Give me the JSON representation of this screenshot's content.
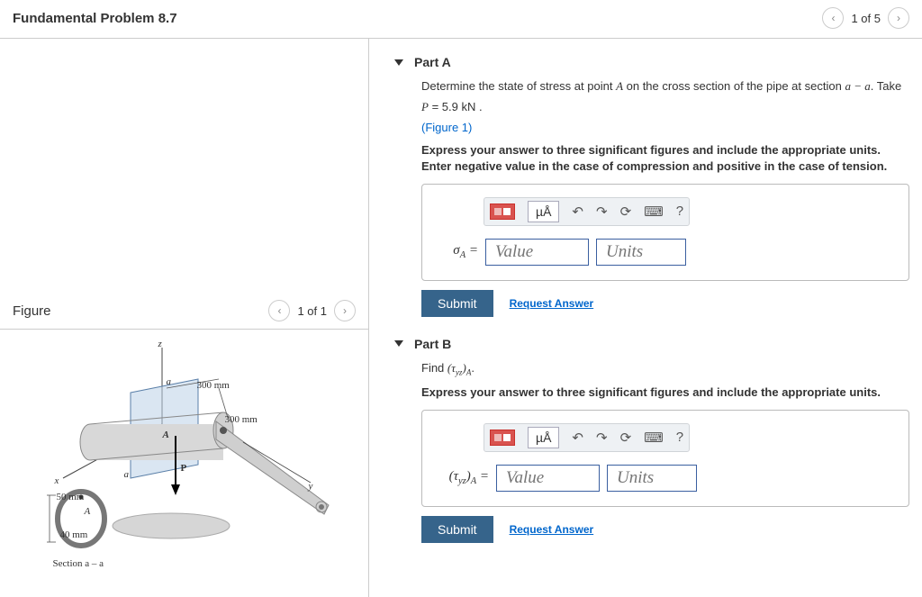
{
  "header": {
    "title": "Fundamental Problem 8.7",
    "page_indicator": "1 of 5"
  },
  "figure_panel": {
    "title": "Figure",
    "page_indicator": "1 of 1",
    "labels": {
      "z": "z",
      "x": "x",
      "y": "y",
      "a1": "a",
      "a2": "a",
      "pointA": "A",
      "ringA": "A",
      "P": "P",
      "dim300a": "300 mm",
      "dim300b": "300 mm",
      "dim50": "50 mm",
      "dim40": "40 mm",
      "section": "Section a – a"
    }
  },
  "partA": {
    "title": "Part A",
    "prompt_pre": "Determine the state of stress at point ",
    "prompt_mid": " on the cross section of the pipe at section ",
    "prompt_post": ". Take",
    "pointA": "A",
    "section_expr": "a − a",
    "p_line_pre": "P",
    "p_line_eq": " = 5.9  kN .",
    "figure_link": "(Figure 1)",
    "instructions": "Express your answer to three significant figures and include the appropriate units. Enter negative value in the case of compression and positive in the case of tension.",
    "units_symbol": "µÅ",
    "help": "?",
    "answer_label_html": "σ<sub>A</sub> =",
    "value_placeholder": "Value",
    "units_placeholder": "Units",
    "submit": "Submit",
    "request": "Request Answer"
  },
  "partB": {
    "title": "Part B",
    "find_pre": "Find ",
    "find_expr": "(τ<sub>yz</sub>)<sub>A</sub>",
    "find_post": ".",
    "instructions": "Express your answer to three significant figures and include the appropriate units.",
    "units_symbol": "µÅ",
    "help": "?",
    "answer_label_html": "(τ<sub>yz</sub>)<sub>A</sub> =",
    "value_placeholder": "Value",
    "units_placeholder": "Units",
    "submit": "Submit",
    "request": "Request Answer"
  }
}
